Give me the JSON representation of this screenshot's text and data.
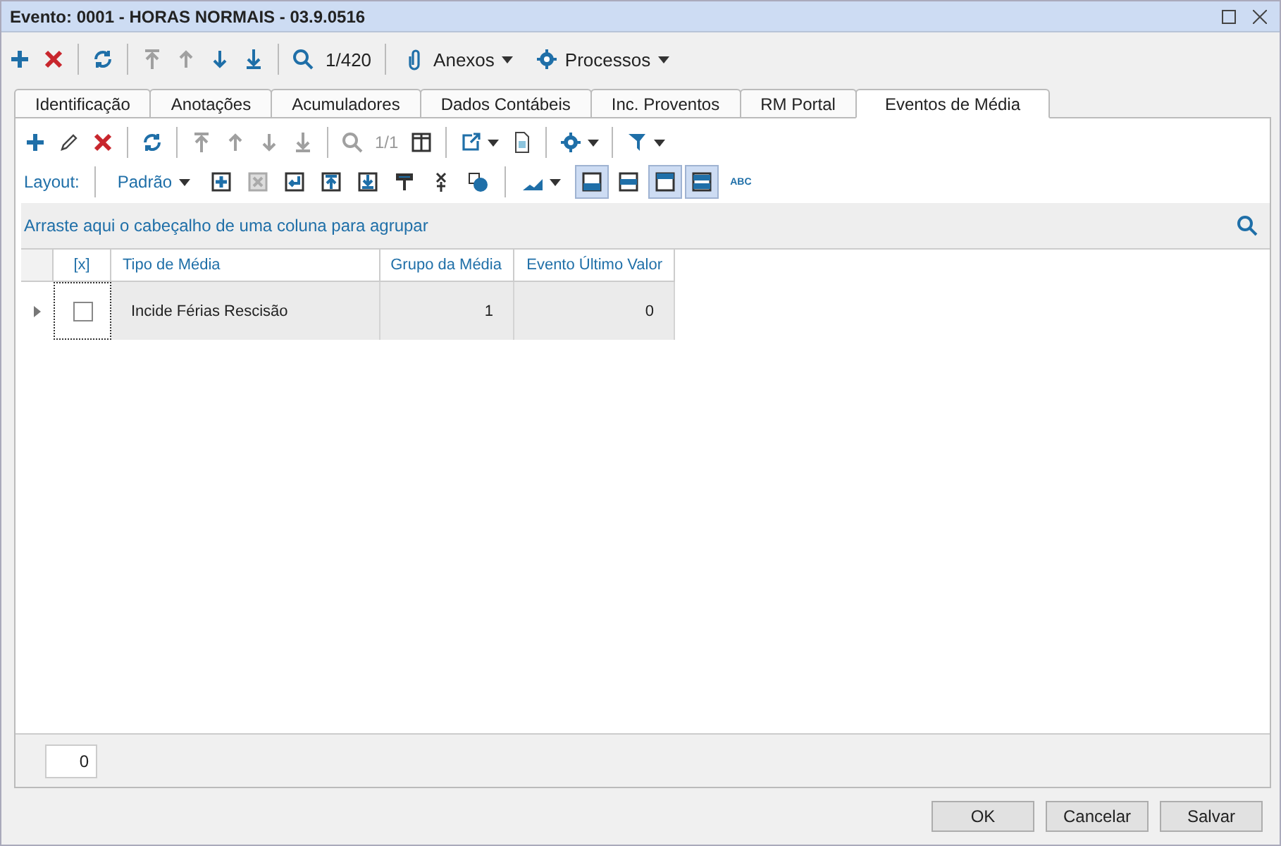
{
  "window": {
    "title": "Evento: 0001 - HORAS NORMAIS - 03.9.0516"
  },
  "toolbar": {
    "nav_buttons": [
      {
        "disabled": true
      },
      {
        "disabled": true
      },
      {
        "disabled": false
      },
      {
        "disabled": false
      }
    ],
    "search": {
      "disabled": false
    },
    "counter": {
      "text": "1/420",
      "disabled": false
    },
    "menus": [
      "Anexos",
      "Processos"
    ]
  },
  "tabs": [
    {
      "label": "Identificação",
      "selected": false
    },
    {
      "label": "Anotações",
      "selected": false
    },
    {
      "label": "Acumuladores",
      "selected": false
    },
    {
      "label": "Dados Contábeis",
      "selected": false
    },
    {
      "label": "Inc. Proventos",
      "selected": false
    },
    {
      "label": "RM Portal",
      "selected": false
    },
    {
      "label": "Eventos de Média",
      "selected": true
    }
  ],
  "grid_toolbar": {
    "nav_buttons": [
      {
        "disabled": true
      },
      {
        "disabled": true
      },
      {
        "disabled": true
      },
      {
        "disabled": true
      }
    ],
    "search": {
      "disabled": true
    },
    "counter": {
      "text": "1/1",
      "disabled": true
    }
  },
  "layout_toolbar": {
    "label": "Layout:",
    "preset": "Padrão",
    "delete_row": {
      "disabled": true
    },
    "toggles": [
      {
        "on": true
      },
      {
        "on": false
      },
      {
        "on": true
      },
      {
        "on": true
      }
    ],
    "spell": "ABC"
  },
  "group_panel": {
    "hint": "Arraste aqui o cabeçalho de uma coluna para agrupar"
  },
  "table": {
    "columns": [
      "[x]",
      "Tipo de Média",
      "Grupo da Média",
      "Evento Último Valor"
    ],
    "rows": [
      {
        "checked": false,
        "cells": [
          "",
          "Incide Férias Rescisão",
          "1",
          "0"
        ]
      }
    ]
  },
  "footer": {
    "count": "0"
  },
  "buttons": [
    "OK",
    "Cancelar",
    "Salvar"
  ]
}
